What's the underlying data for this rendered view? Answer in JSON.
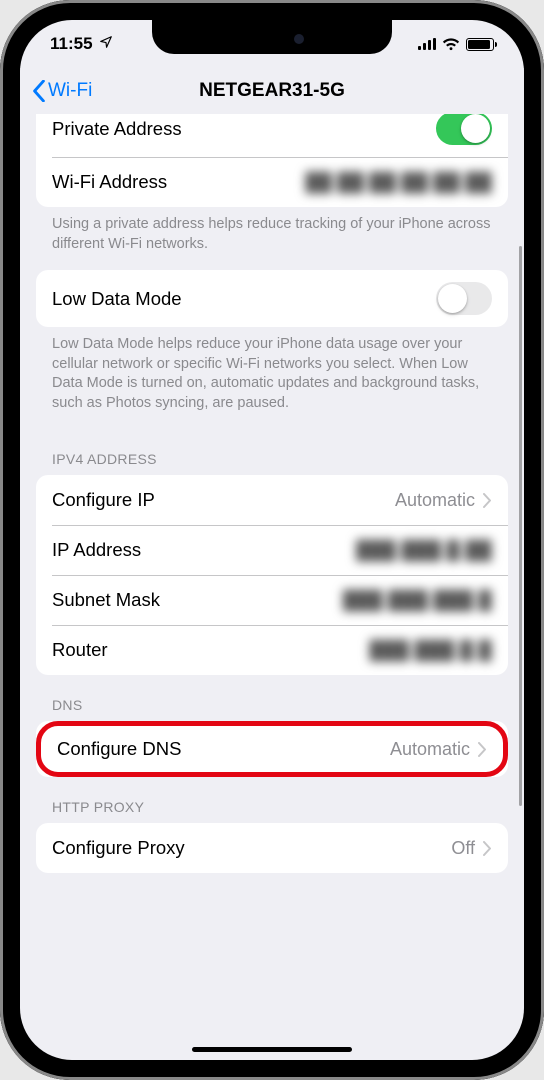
{
  "status": {
    "time": "11:55"
  },
  "nav": {
    "back": "Wi-Fi",
    "title": "NETGEAR31-5G"
  },
  "privacy": {
    "private_address_label": "Private Address",
    "wifi_address_label": "Wi-Fi Address",
    "wifi_address_value": "██:██:██:██:██:██",
    "footer": "Using a private address helps reduce tracking of your iPhone across different Wi-Fi networks."
  },
  "low_data": {
    "label": "Low Data Mode",
    "footer": "Low Data Mode helps reduce your iPhone data usage over your cellular network or specific Wi-Fi networks you select. When Low Data Mode is turned on, automatic updates and background tasks, such as Photos syncing, are paused."
  },
  "ipv4": {
    "header": "IPV4 ADDRESS",
    "configure_ip_label": "Configure IP",
    "configure_ip_value": "Automatic",
    "ip_label": "IP Address",
    "ip_value": "███.███.█.██",
    "subnet_label": "Subnet Mask",
    "subnet_value": "███.███.███.█",
    "router_label": "Router",
    "router_value": "███.███.█.█"
  },
  "dns": {
    "header": "DNS",
    "configure_label": "Configure DNS",
    "configure_value": "Automatic"
  },
  "proxy": {
    "header": "HTTP PROXY",
    "configure_label": "Configure Proxy",
    "configure_value": "Off"
  }
}
